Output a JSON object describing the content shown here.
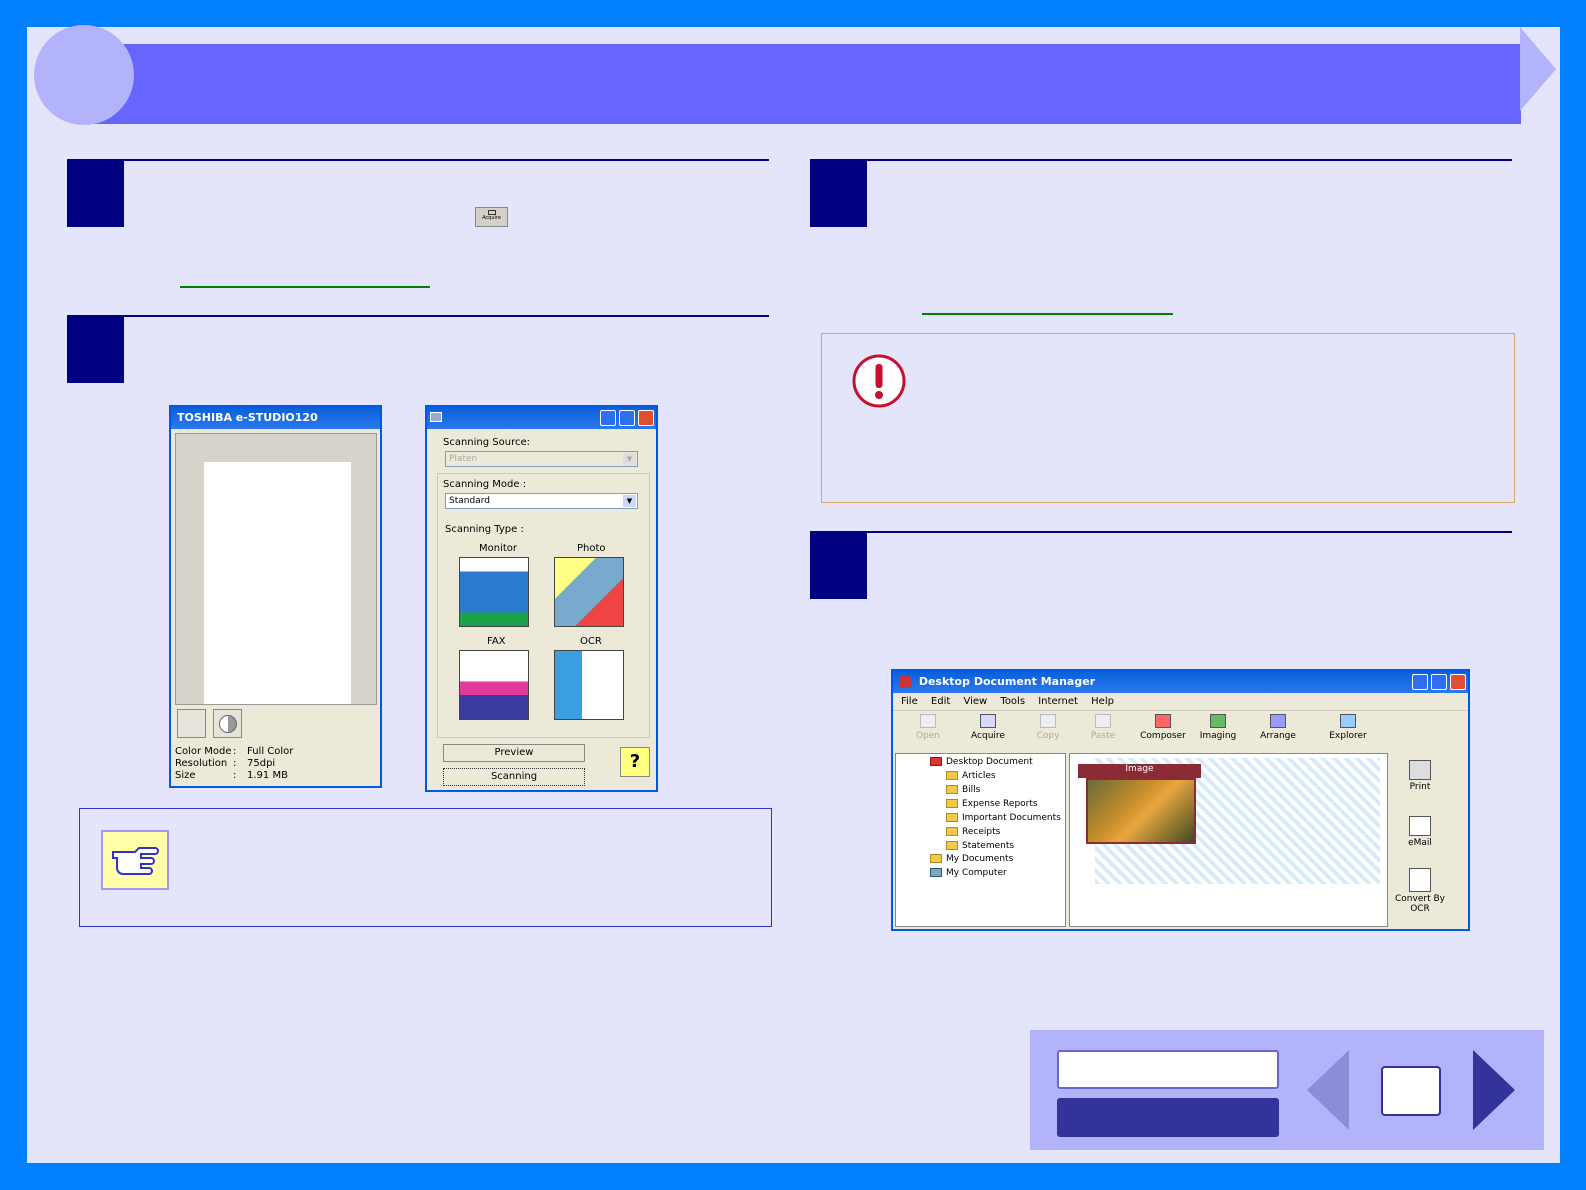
{
  "scan_dialog": {
    "title": "TOSHIBA e-STUDIO120",
    "color_mode_label": "Color Mode",
    "color_mode_value": "Full Color",
    "resolution_label": "Resolution",
    "resolution_value": "75dpi",
    "size_label": "Size",
    "size_value": "1.91 MB",
    "separator": ":"
  },
  "acquire_icon": {
    "label": "Acquire"
  },
  "settings_dialog": {
    "scanning_source_label": "Scanning Source:",
    "scanning_source_value": "Platen",
    "scanning_mode_label": "Scanning Mode :",
    "scanning_mode_value": "Standard",
    "scanning_type_label": "Scanning Type :",
    "types": [
      "Monitor",
      "Photo",
      "FAX",
      "OCR"
    ],
    "preview_button": "Preview",
    "scanning_button": "Scanning",
    "help_glyph": "?"
  },
  "ddm": {
    "title": "Desktop Document Manager",
    "menu": [
      "File",
      "Edit",
      "View",
      "Tools",
      "Internet",
      "Help"
    ],
    "toolbar": [
      "Open",
      "Acquire",
      "Copy",
      "Paste",
      "Composer",
      "Imaging",
      "Arrange",
      "Explorer"
    ],
    "tree": [
      "Desktop Document",
      "Articles",
      "Bills",
      "Expense Reports",
      "Important Documents",
      "Receipts",
      "Statements",
      "My Documents",
      "My Computer"
    ],
    "thumbnail_label": "Image",
    "side_buttons": [
      "Print",
      "eMail",
      "Convert By OCR"
    ]
  },
  "colors": {
    "frame": "#0080ff",
    "page_bg": "#e4e4fa",
    "header": "#6666ff",
    "step_box": "#000080",
    "link_underline": "#008000",
    "caution": "#c8102e"
  },
  "icons": {
    "caution": "caution-icon",
    "note": "pointing-hand-icon",
    "prev": "prev-page-arrow-icon",
    "next": "next-page-arrow-icon"
  }
}
